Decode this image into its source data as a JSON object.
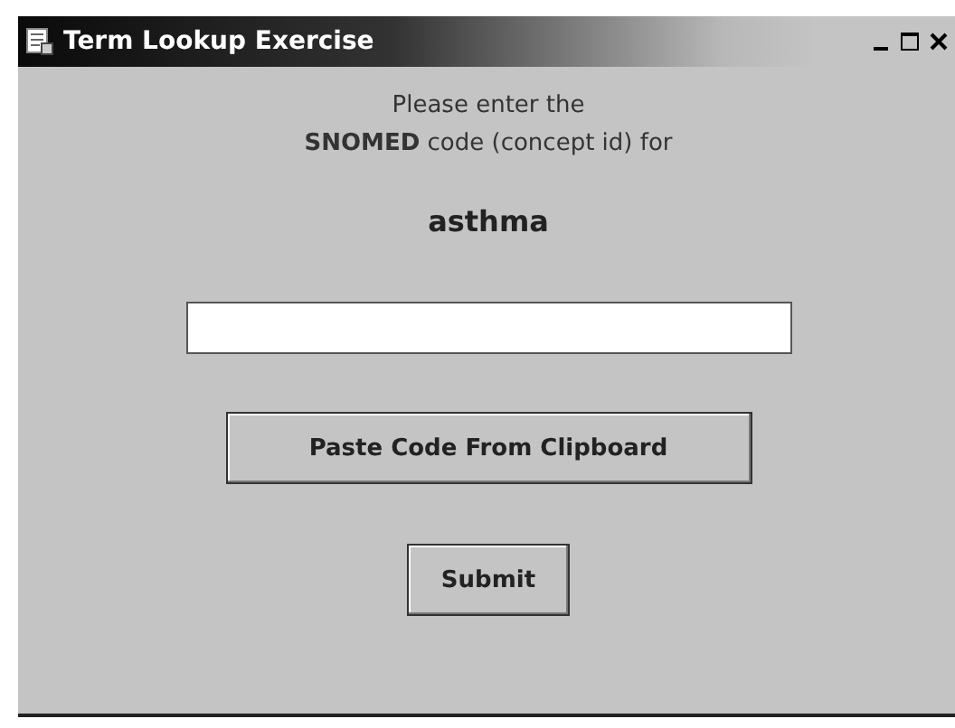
{
  "window": {
    "title": "Term Lookup Exercise"
  },
  "prompt": {
    "line_1": "Please enter the",
    "line_2": "**SNOMED** code (concept id) for"
  },
  "term": "asthma",
  "buttons": [
    {
      "label": "Paste Code From Clipboard"
    },
    {
      "label": "Submit"
    }
  ]
}
